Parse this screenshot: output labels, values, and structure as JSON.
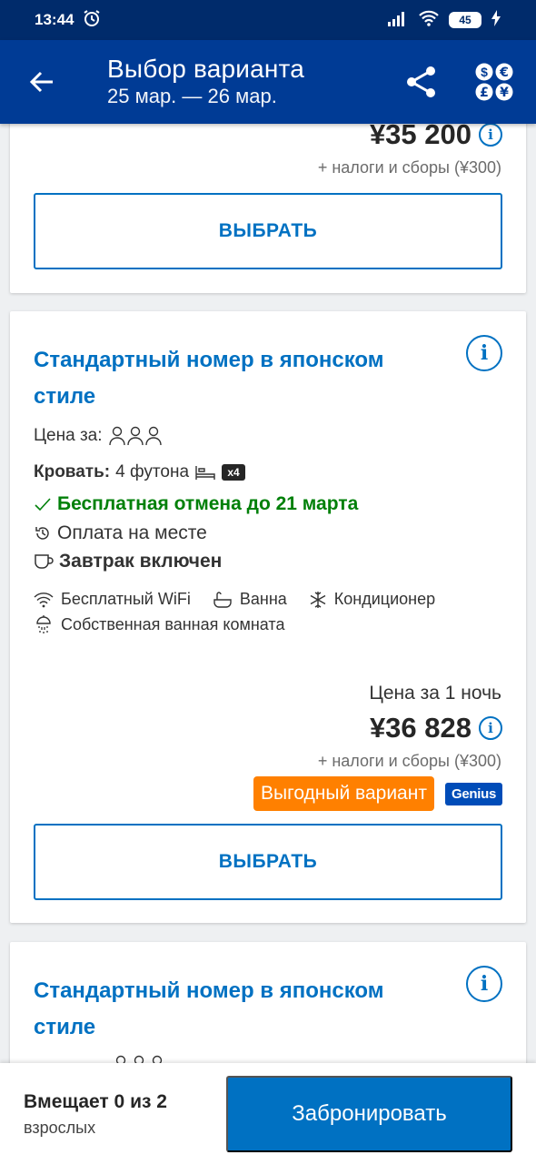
{
  "status_bar": {
    "time": "13:44",
    "battery": "45"
  },
  "header": {
    "title": "Выбор варианта",
    "dates": "25 мар. — 26 мар."
  },
  "card1": {
    "price": "¥35 200",
    "taxes": "+ налоги и сборы (¥300)",
    "select_label": "ВЫБРАТЬ"
  },
  "card2": {
    "title": "Стандартный номер в японском стиле",
    "price_for_label": "Цена за:",
    "bed_label": "Кровать:",
    "bed_value": "4 футона",
    "bed_count": "x4",
    "free_cancel": "Бесплатная отмена до 21 марта",
    "pay_on_site": "Оплата на месте",
    "breakfast": "Завтрак включен",
    "amenities": [
      "Бесплатный WiFi",
      "Ванна",
      "Кондиционер",
      "Собственная ванная комната"
    ],
    "per_night": "Цена за 1 ночь",
    "price": "¥36 828",
    "taxes": "+ налоги и сборы (¥300)",
    "deal_badge": "Выгодный вариант",
    "genius_badge": "Genius",
    "select_label": "ВЫБРАТЬ"
  },
  "card3": {
    "title": "Стандартный номер в японском стиле"
  },
  "bottom_bar": {
    "occupancy_main": "Вмещает 0 из 2",
    "occupancy_sub": "взрослых",
    "book_label": "Забронировать"
  },
  "colors": {
    "header_bg": "#003b95",
    "accent": "#0071c2",
    "green": "#008009",
    "deal": "#ff8000",
    "genius": "#004cb8"
  }
}
